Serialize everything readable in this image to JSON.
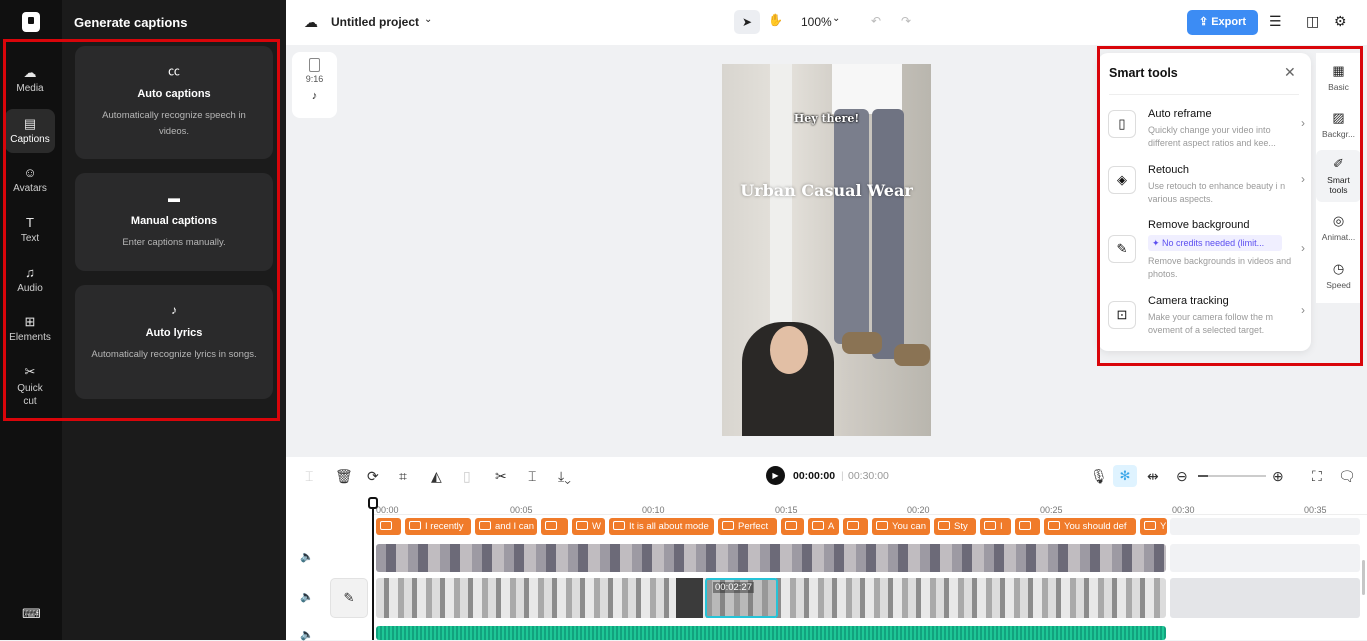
{
  "panel": {
    "title": "Generate captions"
  },
  "rail": [
    {
      "label": "Media",
      "icon": "cloud-upload-icon"
    },
    {
      "label": "Captions",
      "icon": "captions-icon",
      "active": true
    },
    {
      "label": "Avatars",
      "icon": "avatar-icon"
    },
    {
      "label": "Text",
      "icon": "text-icon"
    },
    {
      "label": "Audio",
      "icon": "music-note-icon"
    },
    {
      "label": "Elements",
      "icon": "elements-icon"
    },
    {
      "label": "Quick",
      "label2": "cut",
      "icon": "quick-cut-icon"
    }
  ],
  "cards": [
    {
      "title": "Auto captions",
      "desc": "Automatically recognize speech in videos.",
      "icon": "cc-icon"
    },
    {
      "title": "Manual captions",
      "desc": "Enter captions manually.",
      "icon": "keyboard-icon"
    },
    {
      "title": "Auto lyrics",
      "desc": "Automatically recognize lyrics in songs.",
      "icon": "lyrics-icon"
    }
  ],
  "topbar": {
    "project": "Untitled project",
    "zoom": "100%",
    "export": "Export"
  },
  "ratio": {
    "label": "9:16"
  },
  "video": {
    "text1": "Hey there!",
    "text2": "Urban Casual Wear"
  },
  "smart": {
    "title": "Smart tools",
    "tools": [
      {
        "name": "Auto reframe",
        "desc": "Quickly change your video into different aspect ratios and kee...",
        "icon": "reframe-icon"
      },
      {
        "name": "Retouch",
        "desc": "Use retouch to enhance beauty i n various aspects.",
        "icon": "retouch-icon"
      },
      {
        "name": "Remove background",
        "badge": "✦ No credits needed (limit...",
        "desc": "Remove backgrounds in videos and photos.",
        "icon": "remove-bg-icon"
      },
      {
        "name": "Camera tracking",
        "desc": "Make your camera follow the m ovement of a selected target.",
        "icon": "camera-tracking-icon"
      }
    ]
  },
  "side": [
    {
      "label": "Basic",
      "icon": "basic-icon"
    },
    {
      "label": "Backgr...",
      "icon": "background-icon"
    },
    {
      "label": "Smart tools",
      "icon": "magic-wand-icon",
      "active": true
    },
    {
      "label": "Animat...",
      "icon": "animation-icon"
    },
    {
      "label": "Speed",
      "icon": "speed-icon"
    }
  ],
  "player": {
    "current": "00:00:00",
    "total": "00:30:00"
  },
  "ticks": [
    "00:00",
    "00:05",
    "00:10",
    "00:15",
    "00:20",
    "00:25",
    "00:30",
    "00:35"
  ],
  "captions": [
    {
      "t": ""
    },
    {
      "t": "I recently"
    },
    {
      "t": "and I can"
    },
    {
      "t": ""
    },
    {
      "t": "W"
    },
    {
      "t": "It is all about mode"
    },
    {
      "t": "Perfect"
    },
    {
      "t": ""
    },
    {
      "t": "A"
    },
    {
      "t": ""
    },
    {
      "t": "You can"
    },
    {
      "t": "Sty"
    },
    {
      "t": "I"
    },
    {
      "t": ""
    },
    {
      "t": "You should def"
    },
    {
      "t": "Y"
    }
  ],
  "clip_time": "00:02:27"
}
